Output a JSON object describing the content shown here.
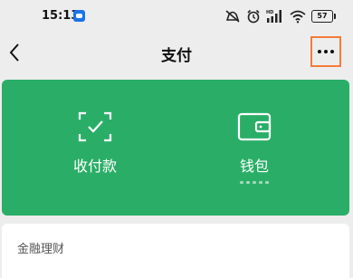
{
  "status_bar": {
    "time": "15:13",
    "battery": "57",
    "icons": [
      "app-notification-icon",
      "mute-vibrate-icon",
      "alarm-icon",
      "hd-signal-icon",
      "wifi-icon",
      "battery-icon"
    ]
  },
  "header": {
    "title": "支付",
    "back_icon": "chevron-left-icon",
    "more_icon": "more-dots-icon",
    "highlight_color": "#f47b3a"
  },
  "pay_card": {
    "background": "#2aae67",
    "actions": [
      {
        "label": "收付款",
        "icon": "scan-check-icon"
      },
      {
        "label": "钱包",
        "icon": "wallet-icon"
      }
    ]
  },
  "finance": {
    "title": "金融理财"
  }
}
